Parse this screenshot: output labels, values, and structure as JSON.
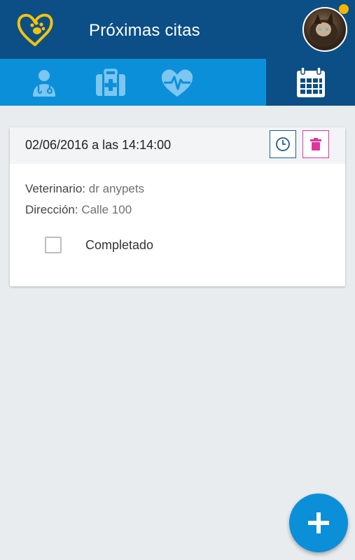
{
  "header": {
    "title": "Próximas citas",
    "logo_icon": "heart-paw-logo",
    "avatar_icon": "user-avatar",
    "notification_color": "#f7b500",
    "background": "#0c4f86"
  },
  "tabs": [
    {
      "icon": "vet-doctor-icon"
    },
    {
      "icon": "medical-kit-icon"
    },
    {
      "icon": "heartbeat-icon"
    },
    {
      "icon": "calendar-icon",
      "active": true
    }
  ],
  "appointment": {
    "date": "02/06/2016 a las 14:14:00",
    "vet_label": "Veterinario:",
    "vet_value": "dr anypets",
    "address_label": "Dirección:",
    "address_value": "Calle 100",
    "completed_label": "Completado",
    "completed": false
  },
  "colors": {
    "tab_bar": "#0b8fd8",
    "trash_accent": "#e0359c",
    "clock_accent": "#1a5e8f",
    "fab": "#0b8fd8"
  },
  "fab_icon": "plus-icon"
}
